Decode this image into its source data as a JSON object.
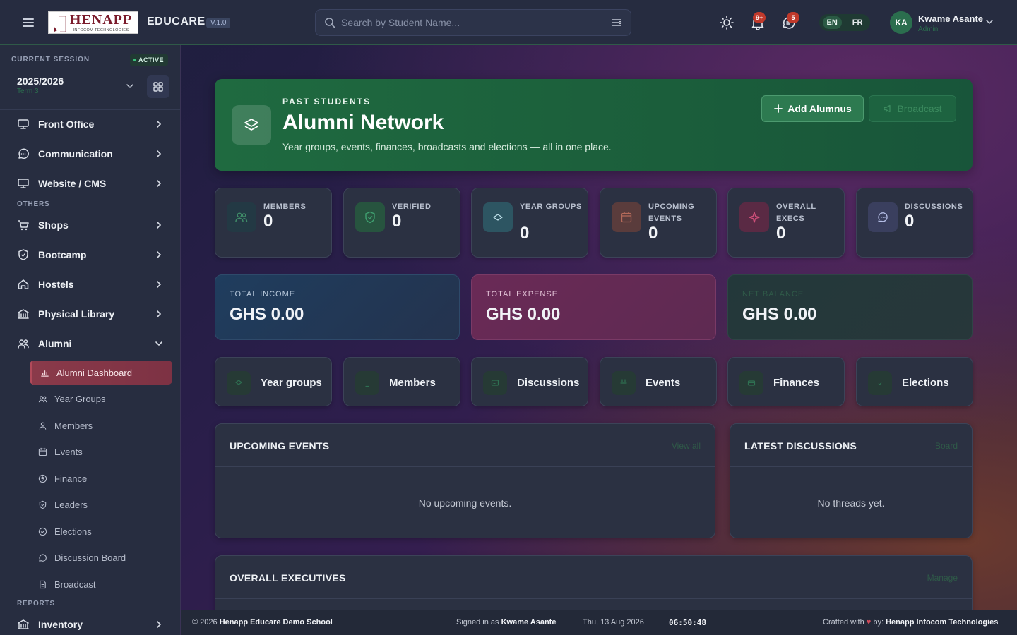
{
  "topbar": {
    "logo_text": "HENAPP",
    "logo_subtext": "INFOCOM TECHNOLOGIES",
    "app_name": "EDUCARE",
    "version": "V.1.0",
    "search_placeholder": "Search by Student Name...",
    "notifications_badge": "9+",
    "messages_badge": "5",
    "languages": [
      "EN",
      "FR"
    ],
    "active_language": "EN",
    "user_initials": "KA",
    "user_name": "Kwame Asante",
    "user_role": "Admin",
    "icons": [
      "menu-icon",
      "search-icon",
      "filter-icon",
      "sun-icon",
      "bell-icon",
      "chat-icon",
      "chevron-down-icon"
    ]
  },
  "sidebar": {
    "session_label": "CURRENT SESSION",
    "session_status": "ACTIVE",
    "session_year": "2025/2026",
    "session_term": "Term 3",
    "items_top": [
      {
        "label": "Front Office",
        "icon": "monitor-icon"
      },
      {
        "label": "Communication",
        "icon": "chat-icon"
      },
      {
        "label": "Website / CMS",
        "icon": "monitor-icon"
      }
    ],
    "section_others": "OTHERS",
    "items_others": [
      {
        "label": "Shops",
        "icon": "cart-icon"
      },
      {
        "label": "Bootcamp",
        "icon": "shield-icon"
      },
      {
        "label": "Hostels",
        "icon": "home-icon"
      },
      {
        "label": "Physical Library",
        "icon": "building-icon"
      },
      {
        "label": "Alumni",
        "icon": "users-icon"
      }
    ],
    "alumni_sub": [
      {
        "label": "Alumni Dashboard",
        "icon": "chart-icon"
      },
      {
        "label": "Year Groups",
        "icon": "users-icon"
      },
      {
        "label": "Members",
        "icon": "user-icon"
      },
      {
        "label": "Events",
        "icon": "calendar-icon"
      },
      {
        "label": "Finance",
        "icon": "coin-icon"
      },
      {
        "label": "Leaders",
        "icon": "shield-icon"
      },
      {
        "label": "Elections",
        "icon": "check-circle-icon"
      },
      {
        "label": "Discussion Board",
        "icon": "chat-icon"
      },
      {
        "label": "Broadcast",
        "icon": "document-icon"
      }
    ],
    "section_reports": "REPORTS",
    "items_reports": [
      {
        "label": "Inventory",
        "icon": "building-icon"
      }
    ]
  },
  "hero": {
    "eyebrow": "PAST STUDENTS",
    "title": "Alumni Network",
    "subtitle": "Year groups, events, finances, broadcasts and elections — all in one place.",
    "add_button": "Add Alumnus",
    "broadcast_button": "Broadcast"
  },
  "stats": [
    {
      "label": "MEMBERS",
      "value": "0",
      "icon": "users-icon",
      "color": "#233944"
    },
    {
      "label": "VERIFIED",
      "value": "0",
      "icon": "shield-icon",
      "color": "#27543f"
    },
    {
      "label": "YEAR GROUPS",
      "value": "0",
      "icon": "layers-icon",
      "color": "#2d5562"
    },
    {
      "label": "UPCOMING EVENTS",
      "value": "0",
      "icon": "calendar-icon",
      "color": "#5a3c3c"
    },
    {
      "label": "OVERALL EXECS",
      "value": "0",
      "icon": "sparkle-icon",
      "color": "#5a2a44"
    },
    {
      "label": "DISCUSSIONS",
      "value": "0",
      "icon": "chat-icon",
      "color": "#3a3f5e"
    }
  ],
  "finance": {
    "income_label": "TOTAL INCOME",
    "income_value": "GHS 0.00",
    "expense_label": "TOTAL EXPENSE",
    "expense_value": "GHS 0.00",
    "balance_label": "NET BALANCE",
    "balance_value": "GHS 0.00"
  },
  "quick_links": [
    {
      "label": "Year groups",
      "icon": "layers-icon"
    },
    {
      "label": "Members",
      "icon": "user-icon"
    },
    {
      "label": "Discussions",
      "icon": "chat-icon"
    },
    {
      "label": "Events",
      "icon": "calendar-icon"
    },
    {
      "label": "Finances",
      "icon": "wallet-icon"
    },
    {
      "label": "Elections",
      "icon": "check-icon"
    }
  ],
  "panels": {
    "events_title": "UPCOMING EVENTS",
    "events_link": "View all",
    "events_empty": "No upcoming events.",
    "discussions_title": "LATEST DISCUSSIONS",
    "discussions_link": "Board",
    "discussions_empty": "No threads yet.",
    "execs_title": "OVERALL EXECUTIVES",
    "execs_link": "Manage"
  },
  "footer": {
    "copyright_prefix": "© 2026",
    "school": "Henapp Educare Demo School",
    "signed_in_prefix": "Signed in as",
    "signed_in_user": "Kwame Asante",
    "date": "Thu, 13 Aug 2026",
    "time": "06:50:48",
    "crafted_prefix": "Crafted with",
    "crafted_by": "by:",
    "company": "Henapp Infocom Technologies"
  },
  "colors": {
    "accent_green": "#1f6a40",
    "active_item": "#8a3a4a",
    "income_card": "#1f3a5a",
    "expense_card": "#6a2a56",
    "balance_card": "#223a36"
  }
}
